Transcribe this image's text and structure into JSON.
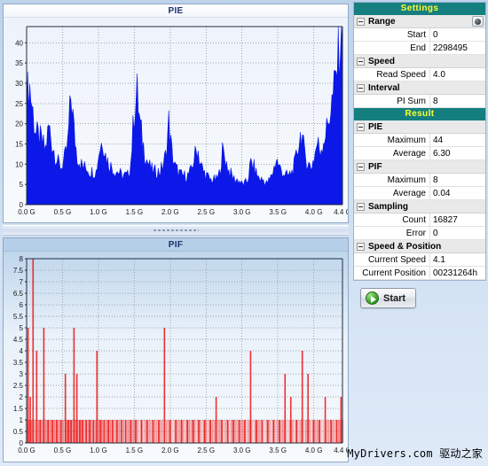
{
  "charts": {
    "pie": {
      "title": "PIE",
      "x_label_suffix": "G",
      "x_ticks": [
        "0.0 G",
        "0.5 G",
        "1.0 G",
        "1.5 G",
        "2.0 G",
        "2.5 G",
        "3.0 G",
        "3.5 G",
        "4.0 G",
        "4.4 G"
      ],
      "y_ticks": [
        "40",
        "35",
        "30",
        "25",
        "20",
        "15",
        "10",
        "5",
        "0"
      ],
      "color": "#0b18e8"
    },
    "pif": {
      "title": "PIF",
      "x_ticks": [
        "0.0 G",
        "0.5 G",
        "1.0 G",
        "1.5 G",
        "2.0 G",
        "2.5 G",
        "3.0 G",
        "3.5 G",
        "4.0 G",
        "4.4 G"
      ],
      "y_ticks": [
        "8",
        "7.5",
        "7",
        "6.5",
        "6",
        "5.5",
        "5",
        "4.5",
        "4",
        "3.5",
        "3",
        "2.5",
        "2",
        "1.5",
        "1",
        "0.5",
        "0"
      ],
      "color": "#ee1b1b"
    }
  },
  "chart_data": [
    {
      "type": "area",
      "name": "PIE",
      "title": "PIE",
      "xlabel": "",
      "ylabel": "",
      "xlim": [
        0,
        4.4
      ],
      "ylim": [
        0,
        44
      ],
      "xunit": "G",
      "grid": true,
      "color": "#0b18e8",
      "x_tick_values": [
        0.0,
        0.5,
        1.0,
        1.5,
        2.0,
        2.5,
        3.0,
        3.5,
        4.0,
        4.4
      ],
      "x_tick_labels": [
        "0.0 G",
        "0.5 G",
        "1.0 G",
        "1.5 G",
        "2.0 G",
        "2.5 G",
        "3.0 G",
        "3.5 G",
        "4.0 G",
        "4.4 G"
      ],
      "y_tick_values": [
        0,
        5,
        10,
        15,
        20,
        25,
        30,
        35,
        40
      ],
      "maximum": 44,
      "average": 6.3,
      "x": [
        0.0,
        0.04,
        0.09,
        0.13,
        0.18,
        0.22,
        0.26,
        0.31,
        0.35,
        0.4,
        0.44,
        0.48,
        0.53,
        0.57,
        0.62,
        0.66,
        0.7,
        0.75,
        0.79,
        0.84,
        0.88,
        0.92,
        0.97,
        1.01,
        1.06,
        1.1,
        1.14,
        1.19,
        1.23,
        1.28,
        1.32,
        1.36,
        1.41,
        1.45,
        1.5,
        1.54,
        1.58,
        1.63,
        1.67,
        1.72,
        1.76,
        1.8,
        1.85,
        1.89,
        1.94,
        1.98,
        2.02,
        2.07,
        2.11,
        2.16,
        2.2,
        2.24,
        2.29,
        2.33,
        2.38,
        2.42,
        2.46,
        2.51,
        2.55,
        2.6,
        2.64,
        2.68,
        2.73,
        2.77,
        2.82,
        2.86,
        2.9,
        2.95,
        2.99,
        3.04,
        3.08,
        3.12,
        3.17,
        3.21,
        3.26,
        3.3,
        3.34,
        3.39,
        3.43,
        3.48,
        3.52,
        3.56,
        3.61,
        3.65,
        3.7,
        3.74,
        3.78,
        3.83,
        3.87,
        3.92,
        3.96,
        4.0,
        4.05,
        4.09,
        4.14,
        4.18,
        4.22,
        4.27,
        4.31,
        4.36,
        4.4
      ],
      "y": [
        26,
        29,
        22,
        17,
        16,
        15,
        13,
        19,
        15,
        12,
        10,
        9,
        11,
        14,
        27,
        18,
        12,
        10,
        9,
        9,
        8,
        8,
        8,
        13,
        16,
        12,
        10,
        9,
        8,
        8,
        7,
        7,
        7,
        10,
        23,
        27,
        19,
        14,
        11,
        9,
        8,
        8,
        8,
        9,
        12,
        20,
        13,
        9,
        8,
        7,
        7,
        7,
        8,
        11,
        14,
        10,
        8,
        7,
        6,
        6,
        6,
        7,
        13,
        11,
        8,
        7,
        6,
        6,
        5,
        5,
        6,
        10,
        9,
        7,
        6,
        6,
        5,
        6,
        8,
        11,
        9,
        8,
        7,
        7,
        8,
        10,
        14,
        18,
        12,
        10,
        9,
        11,
        15,
        13,
        16,
        18,
        22,
        26,
        31,
        38,
        44
      ]
    },
    {
      "type": "bar",
      "name": "PIF",
      "title": "PIF",
      "xlabel": "",
      "ylabel": "",
      "xlim": [
        0,
        4.4
      ],
      "ylim": [
        0,
        8
      ],
      "xunit": "G",
      "grid": true,
      "color": "#ee1b1b",
      "x_tick_values": [
        0.0,
        0.5,
        1.0,
        1.5,
        2.0,
        2.5,
        3.0,
        3.5,
        4.0,
        4.4
      ],
      "x_tick_labels": [
        "0.0 G",
        "0.5 G",
        "1.0 G",
        "1.5 G",
        "2.0 G",
        "2.5 G",
        "3.0 G",
        "3.5 G",
        "4.0 G",
        "4.4 G"
      ],
      "y_tick_values": [
        0,
        0.5,
        1,
        1.5,
        2,
        2.5,
        3,
        3.5,
        4,
        4.5,
        5,
        5.5,
        6,
        6.5,
        7,
        7.5,
        8
      ],
      "maximum": 8,
      "average": 0.04,
      "x": [
        0.02,
        0.05,
        0.09,
        0.14,
        0.19,
        0.24,
        0.3,
        0.36,
        0.42,
        0.48,
        0.54,
        0.58,
        0.62,
        0.66,
        0.7,
        0.74,
        0.78,
        0.83,
        0.88,
        0.93,
        0.98,
        1.03,
        1.08,
        1.14,
        1.2,
        1.26,
        1.32,
        1.38,
        1.45,
        1.52,
        1.6,
        1.68,
        1.76,
        1.84,
        1.92,
        2.0,
        2.08,
        2.16,
        2.24,
        2.32,
        2.4,
        2.48,
        2.56,
        2.64,
        2.72,
        2.8,
        2.88,
        2.96,
        3.04,
        3.12,
        3.2,
        3.28,
        3.36,
        3.44,
        3.52,
        3.6,
        3.68,
        3.76,
        3.84,
        3.92,
        4.0,
        4.08,
        4.16,
        4.24,
        4.32,
        4.38
      ],
      "y": [
        5,
        2,
        8,
        4,
        1,
        5,
        1,
        1,
        1,
        1,
        3,
        1,
        1,
        5,
        3,
        1,
        1,
        1,
        1,
        1,
        4,
        1,
        1,
        1,
        1,
        1,
        1,
        1,
        1,
        1,
        1,
        1,
        1,
        1,
        5,
        1,
        1,
        1,
        1,
        1,
        1,
        1,
        1,
        2,
        1,
        1,
        1,
        1,
        1,
        4,
        1,
        1,
        1,
        1,
        1,
        3,
        2,
        1,
        4,
        3,
        1,
        1,
        2,
        1,
        1,
        2
      ]
    }
  ],
  "settings": {
    "header": "Settings",
    "groups": [
      {
        "title": "Range",
        "has_button": true,
        "rows": [
          {
            "key": "Start",
            "value": "0"
          },
          {
            "key": "End",
            "value": "2298495"
          }
        ]
      },
      {
        "title": "Speed",
        "has_button": false,
        "rows": [
          {
            "key": "Read Speed",
            "value": "4.0"
          }
        ]
      },
      {
        "title": "Interval",
        "has_button": false,
        "rows": [
          {
            "key": "PI Sum",
            "value": "8"
          }
        ]
      }
    ]
  },
  "result": {
    "header": "Result",
    "groups": [
      {
        "title": "PIE",
        "rows": [
          {
            "key": "Maximum",
            "value": "44"
          },
          {
            "key": "Average",
            "value": "6.30"
          }
        ]
      },
      {
        "title": "PIF",
        "rows": [
          {
            "key": "Maximum",
            "value": "8"
          },
          {
            "key": "Average",
            "value": "0.04"
          }
        ]
      },
      {
        "title": "Sampling",
        "rows": [
          {
            "key": "Count",
            "value": "16827"
          },
          {
            "key": "Error",
            "value": "0"
          }
        ]
      },
      {
        "title": "Speed & Position",
        "rows": [
          {
            "key": "Current Speed",
            "value": "4.1"
          },
          {
            "key": "Current Position",
            "value": "00231264h"
          }
        ]
      }
    ]
  },
  "actions": {
    "start_label": "Start"
  },
  "watermark": {
    "text": "MyDrivers.com 驱动之家"
  },
  "colors": {
    "header_bg": "#157f7f",
    "header_text": "#ffff33",
    "pie_series": "#0b18e8",
    "pif_series": "#ee1b1b",
    "app_bg": "#cfe0f2"
  }
}
